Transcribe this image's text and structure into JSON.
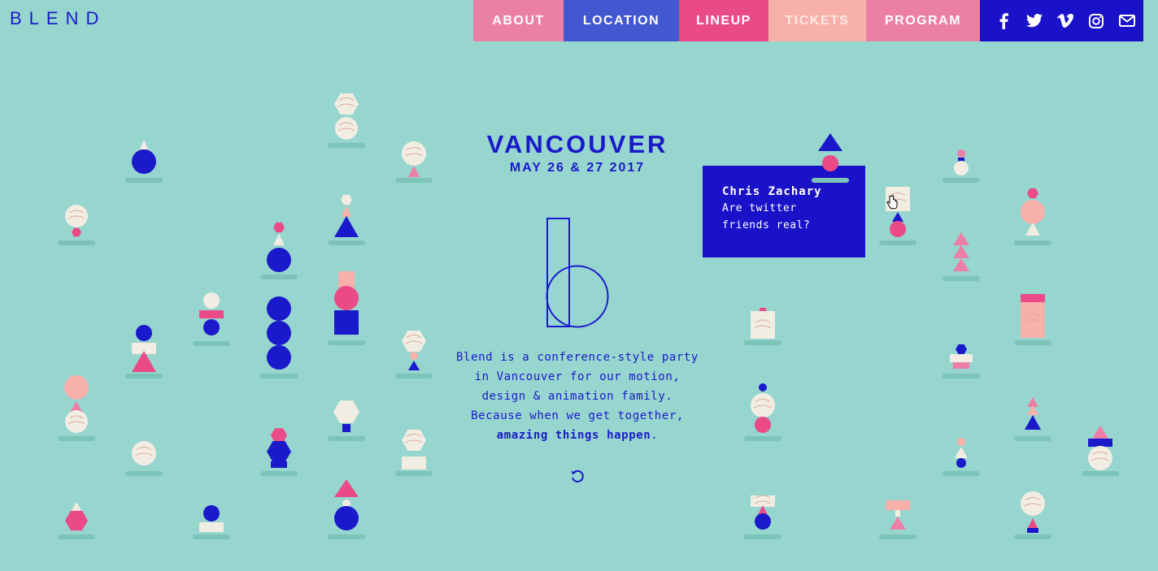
{
  "brand": {
    "logo_text": "BLEND"
  },
  "nav": {
    "items": [
      {
        "label": "ABOUT",
        "color": "#ec7fa6"
      },
      {
        "label": "LOCATION",
        "color": "#4357d0"
      },
      {
        "label": "LINEUP",
        "color": "#ea4b86"
      },
      {
        "label": "TICKETS",
        "color": "#f7b0aa"
      },
      {
        "label": "PROGRAM",
        "color": "#ec7fa6"
      }
    ],
    "social_icons": [
      "facebook-icon",
      "twitter-icon",
      "vimeo-icon",
      "instagram-icon",
      "email-icon"
    ],
    "social_bg": "#1a12c8"
  },
  "hero": {
    "city": "VANCOUVER",
    "date": "MAY 26 & 27 2017",
    "description": "Blend is a conference-style party in Vancouver for our motion, design & animation family. Because when we get together,",
    "highlight": "amazing things happen",
    "trailing": ".",
    "replay_icon": "replay-icon"
  },
  "tooltip": {
    "speaker_name": "Chris Zachary",
    "talk_title": "Are twitter friends real?"
  },
  "colors": {
    "background": "#97d5cf",
    "navy": "#1a1aca",
    "pink": "#ea4b86",
    "light_pink": "#f7b0aa",
    "cream": "#f2ede2",
    "shadow": "#7cc4b8"
  }
}
